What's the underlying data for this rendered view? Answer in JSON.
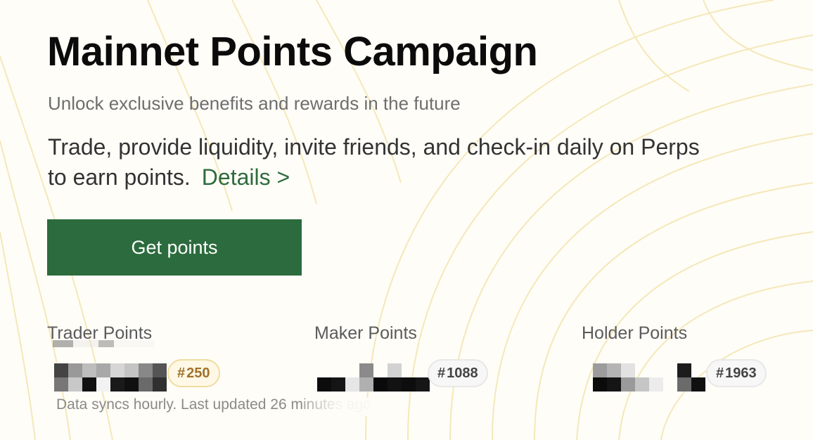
{
  "header": {
    "title": "Mainnet Points Campaign",
    "subtitle": "Unlock exclusive benefits and rewards in the future",
    "description": "Trade, provide liquidity, invite friends, and check-in daily on Perps to earn points.",
    "details_link": "Details >"
  },
  "cta": {
    "label": "Get points"
  },
  "stats": [
    {
      "label": "Trader Points",
      "rank_hash": "#",
      "rank": "250"
    },
    {
      "label": "Maker Points",
      "rank_hash": "#",
      "rank": "1088"
    },
    {
      "label": "Holder Points",
      "rank_hash": "#",
      "rank": "1963"
    }
  ],
  "footer": {
    "sync_note": "Data syncs hourly. Last updated 26 minutes ago"
  },
  "colors": {
    "accent_green": "#2c6b3d",
    "link_green": "#2e6b3e",
    "gold_badge": "#a0722a",
    "background": "#fffdf7"
  }
}
